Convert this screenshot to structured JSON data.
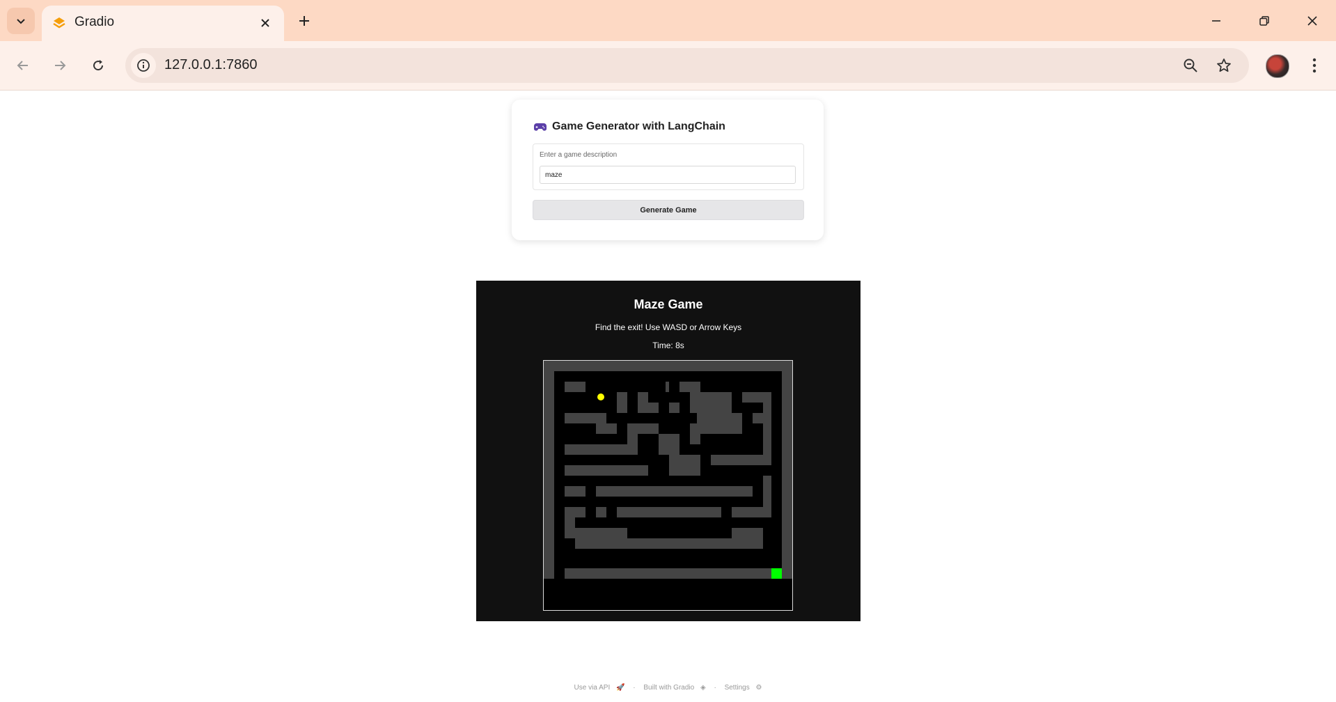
{
  "browser": {
    "tab_title": "Gradio",
    "url": "127.0.0.1:7860"
  },
  "app": {
    "title": "Game Generator with LangChain",
    "input_label": "Enter a game description",
    "input_value": "maze",
    "generate_label": "Generate Game"
  },
  "game": {
    "title": "Maze Game",
    "instructions": "Find the exit! Use WASD or Arrow Keys",
    "time_label": "Time: ",
    "time_value": "8s",
    "colors": {
      "background": "#111111",
      "wall": "#444444",
      "path": "#000000",
      "player": "#ffff00",
      "exit": "#00ff00"
    }
  },
  "footer": {
    "api": "Use via API",
    "built": "Built with Gradio",
    "settings": "Settings",
    "separator": "·"
  }
}
